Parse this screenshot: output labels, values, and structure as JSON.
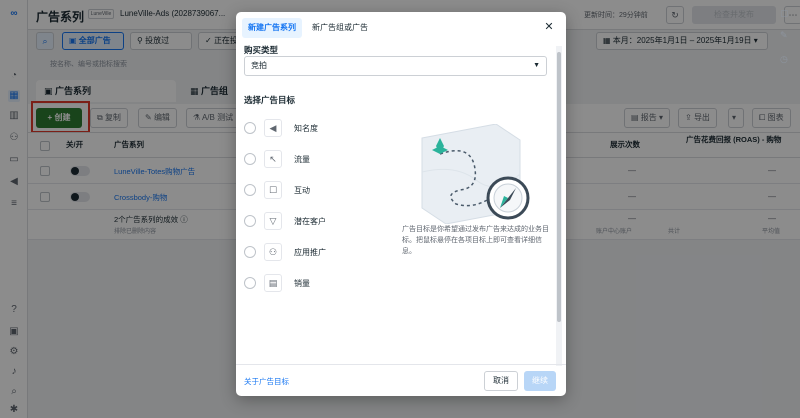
{
  "rail": {
    "icons": [
      "meta-logo-icon",
      "dashboard-icon",
      "table-icon",
      "pages-icon",
      "audience-icon",
      "billing-icon",
      "megaphone-icon",
      "menu-icon",
      "help-icon",
      "grid-icon",
      "settings-icon",
      "bell-icon",
      "search-icon",
      "bug-icon"
    ]
  },
  "header": {
    "title": "广告系列",
    "account_badge": "LuneVille",
    "account": "LuneVille-Ads (2028739067...",
    "updated": "更新时间：29分钟前",
    "review_label": "检查并发布"
  },
  "filters": {
    "all_ads": "全部广告",
    "delivered": "投放过",
    "active": "正在投放的",
    "date_range": "本月：2025年1月1日 – 2025年1月19日",
    "search_placeholder": "按名称、编号或指标搜索"
  },
  "tabs": {
    "campaigns": "广告系列",
    "adsets": "广告组"
  },
  "toolbar": {
    "create": "创建",
    "duplicate": "复制",
    "edit": "编辑",
    "ab_test": "A/B 测试",
    "report": "报告",
    "export": "导出",
    "chart": "图表"
  },
  "table": {
    "headers": {
      "onoff": "关/开",
      "campaign": "广告系列",
      "impressions": "展示次数",
      "roas": "广告花费回报 (ROAS) - 购物"
    },
    "rows": [
      {
        "name": "LuneVille-Totes购物广告"
      },
      {
        "name": "Crossbody-购物"
      }
    ],
    "summary": {
      "title": "2个广告系列的成效",
      "sub": "排除已删除内容",
      "account_center": "账户中心账户",
      "total": "共计",
      "avg": "平均值"
    }
  },
  "modal": {
    "tab_new": "新建广告系列",
    "tab_new_group": "新广告组或广告",
    "buy_type_label": "购买类型",
    "buy_type_value": "竞拍",
    "objective_label": "选择广告目标",
    "objectives": [
      {
        "label": "知名度",
        "icon": "megaphone-icon"
      },
      {
        "label": "流量",
        "icon": "cursor-icon"
      },
      {
        "label": "互动",
        "icon": "chat-icon"
      },
      {
        "label": "潜在客户",
        "icon": "filter-icon"
      },
      {
        "label": "应用推广",
        "icon": "people-icon"
      },
      {
        "label": "销量",
        "icon": "bag-icon"
      }
    ],
    "description": "广告目标是你希望通过发布广告来达成的业务目标。把鼠标悬停在各项目标上即可查看详细信息。",
    "about_link": "关于广告目标",
    "cancel": "取消",
    "continue": "继续"
  },
  "colors": {
    "accent": "#1877f2",
    "create_green": "#2e7d32",
    "highlight_red": "#e0392b"
  }
}
